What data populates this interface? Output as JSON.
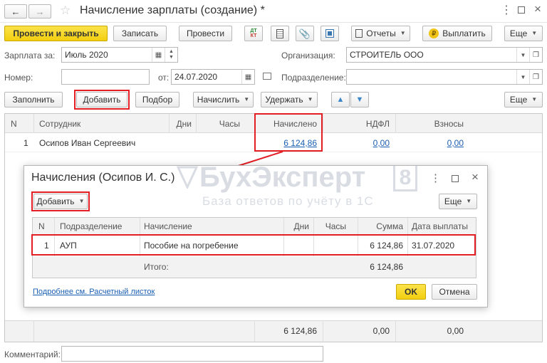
{
  "window": {
    "title": "Начисление зарплаты (создание) *"
  },
  "toolbar": {
    "post_and_close": "Провести и закрыть",
    "save": "Записать",
    "post": "Провести",
    "reports": "Отчеты",
    "pay": "Выплатить",
    "more": "Еще"
  },
  "form": {
    "salary_for_label": "Зарплата за:",
    "salary_for_value": "Июль 2020",
    "org_label": "Организация:",
    "org_value": "СТРОИТЕЛЬ ООО",
    "number_label": "Номер:",
    "number_value": "",
    "date_from_label": "от:",
    "date_value": "24.07.2020",
    "division_label": "Подразделение:",
    "division_value": ""
  },
  "actions": {
    "fill": "Заполнить",
    "add": "Добавить",
    "selection": "Подбор",
    "accrue": "Начислить",
    "withhold": "Удержать",
    "more": "Еще"
  },
  "main_table": {
    "headers": [
      "N",
      "Сотрудник",
      "Дни",
      "Часы",
      "Начислено",
      "НДФЛ",
      "Взносы"
    ],
    "rows": [
      {
        "n": "1",
        "employee": "Осипов Иван Сергеевич",
        "days": "",
        "hours": "",
        "accrued": "6 124,86",
        "ndfl": "0,00",
        "contrib": "0,00"
      }
    ],
    "totals": {
      "accrued": "6 124,86",
      "ndfl": "0,00",
      "contrib": "0,00"
    }
  },
  "comment": {
    "label": "Комментарий:",
    "value": ""
  },
  "dialog": {
    "title": "Начисления (Осипов И. С.)",
    "add": "Добавить",
    "more": "Еще",
    "headers": [
      "N",
      "Подразделение",
      "Начисление",
      "Дни",
      "Часы",
      "Сумма",
      "Дата выплаты"
    ],
    "rows": [
      {
        "n": "1",
        "division": "АУП",
        "accrual": "Пособие на погребение",
        "days": "",
        "hours": "",
        "sum": "6 124,86",
        "pay_date": "31.07.2020"
      }
    ],
    "total_label": "Итого:",
    "total_sum": "6 124,86",
    "payslip_link": "Подробнее см. Расчетный листок",
    "ok": "OK",
    "cancel": "Отмена"
  },
  "watermark": {
    "brand": "БухЭксперт",
    "digit": "8",
    "tagline": "База ответов по учёту в 1С"
  },
  "colors": {
    "highlight": "#e31e24",
    "primary_button": "#f5d320",
    "link": "#1a5fb4"
  }
}
